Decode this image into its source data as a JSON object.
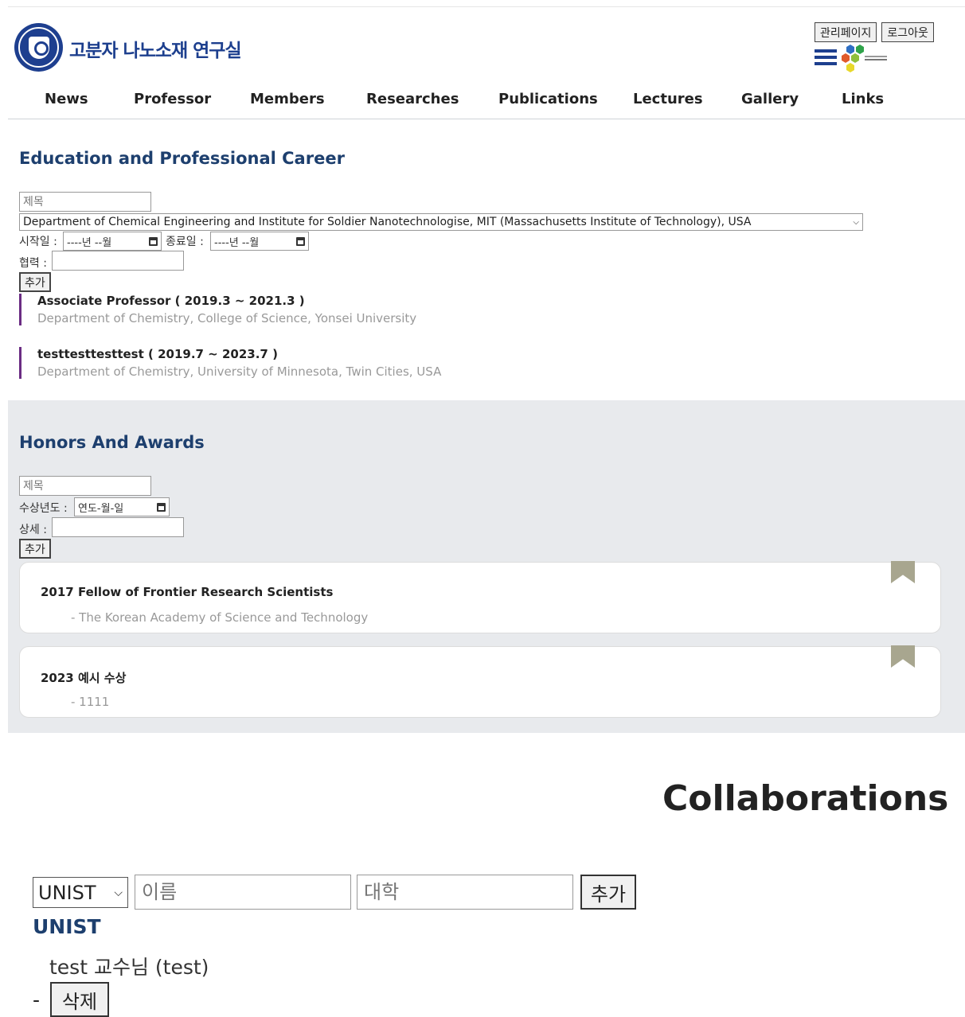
{
  "header": {
    "brand_title": "고분자 나노소재 연구실",
    "admin_page_label": "관리페이지",
    "logout_label": "로그아웃"
  },
  "nav": {
    "items": [
      "News",
      "Professor",
      "Members",
      "Researches",
      "Publications",
      "Lectures",
      "Gallery",
      "Links"
    ]
  },
  "education": {
    "heading": "Education and Professional Career",
    "title_placeholder": "제목",
    "institution_selected": "Department of Chemical Engineering and Institute for Soldier Nanotechnologise, MIT (Massachusetts Institute of Technology), USA",
    "start_label": "시작일 :",
    "start_value": "----년 --월",
    "end_label": "종료일 :",
    "end_value": "----년 --월",
    "collab_label": "협력 :",
    "add_label": "추가",
    "entries": [
      {
        "title": "Associate Professor ( 2019.3 ~ 2021.3 )",
        "desc": "Department of Chemistry, College of Science, Yonsei University"
      },
      {
        "title": "testtesttesttest ( 2019.7 ~ 2023.7 )",
        "desc": "Department of Chemistry, University of Minnesota, Twin Cities, USA"
      }
    ]
  },
  "honors": {
    "heading": "Honors And Awards",
    "title_placeholder": "제목",
    "year_label": "수상년도 :",
    "year_value": "연도-월-일",
    "detail_label": "상세 :",
    "add_label": "추가",
    "awards": [
      {
        "title": "2017 Fellow of Frontier Research Scientists",
        "desc": "- The Korean Academy of Science and Technology"
      },
      {
        "title": "2023 예시 수상",
        "desc": "- 1111"
      }
    ]
  },
  "collaborations": {
    "heading": "Collaborations",
    "select_value": "UNIST",
    "name_placeholder": "이름",
    "univ_placeholder": "대학",
    "add_label": "추가",
    "group_name": "UNIST",
    "member": "test 교수님 (test)",
    "dash": "-",
    "delete_label": "삭제"
  },
  "colors": {
    "brand_blue": "#1d3f8e",
    "heading_blue": "#1d3f6e",
    "career_accent": "#6b2c83",
    "ribbon": "#a8a68f",
    "section_gray": "#e8eaed"
  }
}
